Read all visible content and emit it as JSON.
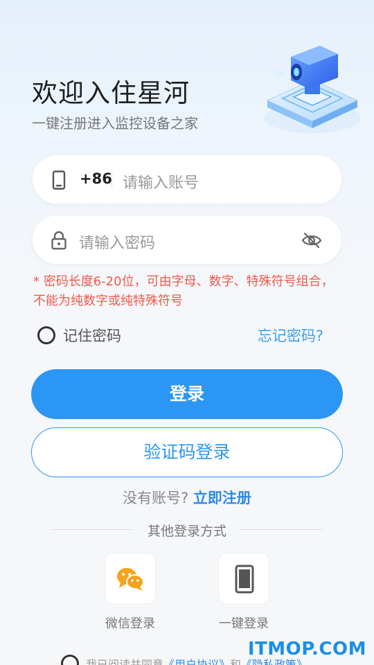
{
  "header": {
    "title": "欢迎入住星河",
    "subtitle": "一键注册进入监控设备之家"
  },
  "phone": {
    "icon": "phone-icon",
    "country_code": "+86",
    "placeholder": "请输入账号"
  },
  "password": {
    "icon": "lock-icon",
    "placeholder": "请输入密码",
    "visibility_icon": "eye-off-icon"
  },
  "hint": "* 密码长度6-20位，可由字母、数字、特殊符号组合，不能为纯数字或纯特殊符号",
  "remember": {
    "label": "记住密码",
    "checked": false
  },
  "forgot": "忘记密码?",
  "buttons": {
    "login": "登录",
    "sms_login": "验证码登录"
  },
  "register": {
    "prompt": "没有账号?",
    "link": "立即注册"
  },
  "other_login": {
    "title": "其他登录方式",
    "options": [
      {
        "label": "微信登录",
        "icon": "wechat-icon"
      },
      {
        "label": "一键登录",
        "icon": "phone-icon"
      }
    ]
  },
  "agreement": {
    "prefix": "我已阅读并同意",
    "user_agreement": "《用户协议》",
    "and": "和",
    "privacy_policy": "《隐私政策》"
  },
  "watermark": "ITMOP.COM",
  "colors": {
    "primary": "#2b96f3",
    "hint": "#ef5a4a",
    "wechat": "#f7a21b"
  }
}
